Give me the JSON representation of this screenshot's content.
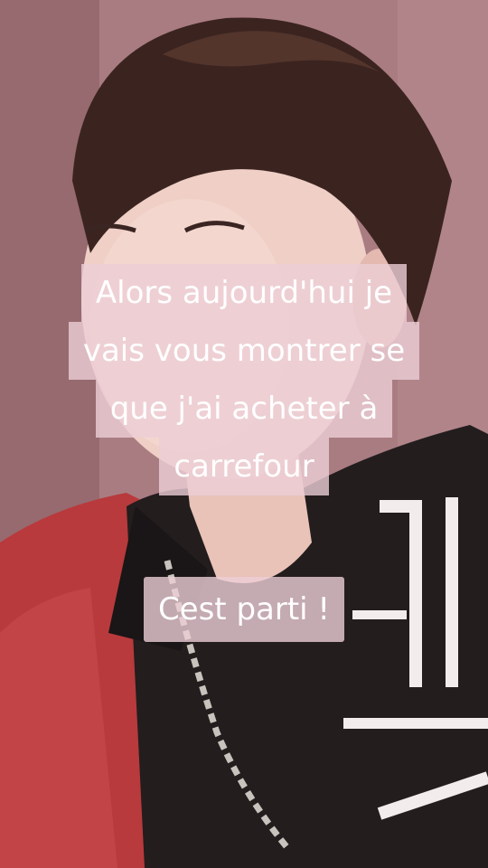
{
  "captions": {
    "intro_lines": [
      "Alors aujourd'hui je",
      "vais vous montrer se",
      "que j'ai acheter à",
      "carrefour"
    ],
    "start_text": "Cest parti !"
  },
  "colors": {
    "caption_bg": "#ECCED6",
    "caption_text": "#FFFFFF",
    "backdrop": "#B78890"
  }
}
